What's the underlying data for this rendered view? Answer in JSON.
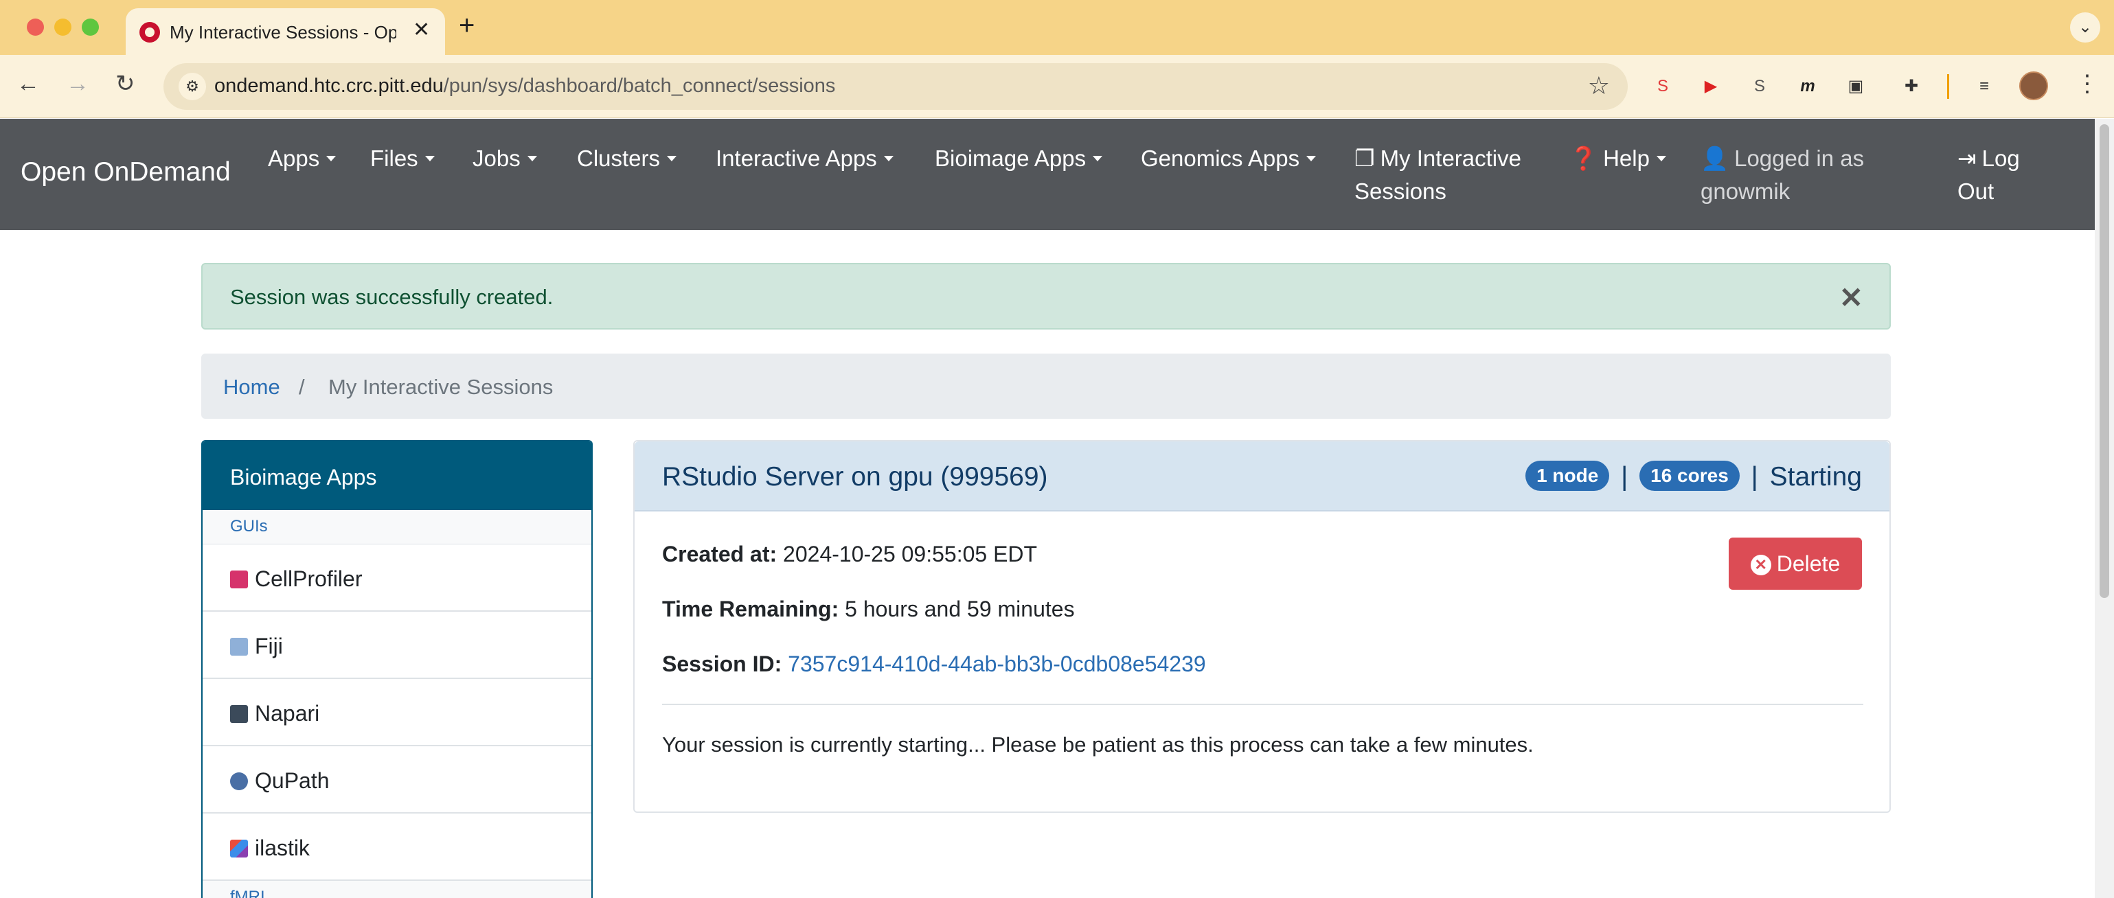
{
  "browser": {
    "tab_title": "My Interactive Sessions - Open OnDemand",
    "tab_close": "✕",
    "new_tab": "+",
    "url_host": "ondemand.htc.crc.pitt.edu",
    "url_path": "/pun/sys/dashboard/batch_connect/sessions",
    "icons": [
      "back-icon",
      "forward-icon",
      "reload-icon",
      "site-info-icon",
      "bookmark-star-icon",
      "extensions-icon",
      "profile-avatar",
      "menu-icon"
    ]
  },
  "navbar": {
    "brand": "Open OnDemand",
    "menus": [
      "Apps",
      "Files",
      "Jobs",
      "Clusters",
      "Interactive Apps",
      "Bioimage Apps",
      "Genomics Apps"
    ],
    "sessions_line1": "My Interactive",
    "sessions_line2": "Sessions",
    "help": "Help",
    "logged_line1": "Logged in as",
    "logged_line2": "gnowmik",
    "logout_line1": "Log",
    "logout_line2": "Out"
  },
  "alert": {
    "message": "Session was successfully created.",
    "close": "✕",
    "color": "#d1e7dd"
  },
  "breadcrumb": {
    "home": "Home",
    "separator": "/",
    "current": "My Interactive Sessions"
  },
  "sidebar": {
    "title": "Bioimage Apps",
    "group_gui": "GUIs",
    "items": [
      {
        "label": "CellProfiler",
        "icon": "cellprofiler-icon",
        "color": "#d6336c"
      },
      {
        "label": "Fiji",
        "icon": "fiji-icon",
        "color": "#6c8ebf"
      },
      {
        "label": "Napari",
        "icon": "napari-icon",
        "color": "#3b4a5a"
      },
      {
        "label": "QuPath",
        "icon": "qupath-icon",
        "color": "#4a6fa5"
      },
      {
        "label": "ilastik",
        "icon": "ilastik-icon",
        "color": "#8a3fb0"
      }
    ],
    "group_next": "fMRI"
  },
  "session": {
    "title": "RStudio Server on gpu (999569)",
    "nodes": "1 node",
    "cores": "16 cores",
    "separator": "|",
    "status": "Starting",
    "created_label": "Created at:",
    "created_value": "2024-10-25 09:55:05 EDT",
    "time_label": "Time Remaining:",
    "time_value": "5 hours and 59 minutes",
    "id_label": "Session ID:",
    "id_value": "7357c914-410d-44ab-bb3b-0cdb08e54239",
    "delete": "Delete",
    "message": "Your session is currently starting... Please be patient as this process can take a few minutes."
  },
  "colors": {
    "navbar": "#53565a",
    "sidebar_header": "#005a7c",
    "badge": "#2a6db3",
    "delete_button": "#dc4c55"
  }
}
